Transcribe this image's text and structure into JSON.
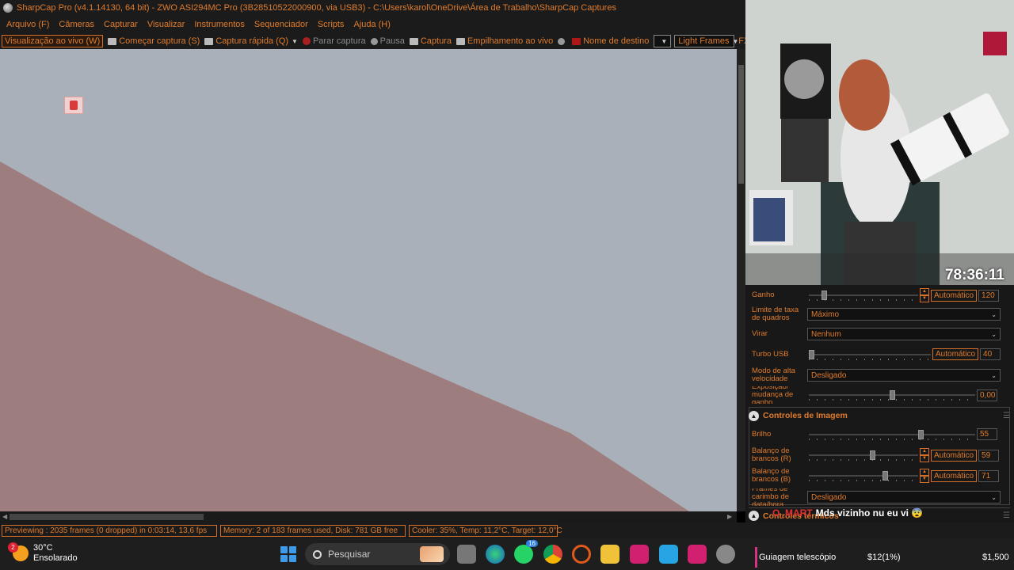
{
  "window": {
    "title": "SharpCap Pro (v4.1.14130, 64 bit) - ZWO ASI294MC Pro (3B28510522000900, via USB3) - C:\\Users\\karol\\OneDrive\\Área de Trabalho\\SharpCap Captures"
  },
  "menu": [
    "Arquivo (F)",
    "Câmeras",
    "Capturar",
    "Visualizar",
    "Instrumentos",
    "Sequenciador",
    "Scripts",
    "Ajuda (H)"
  ],
  "toolbar": {
    "live_view": "Visualização ao vivo (W)",
    "start_capture": "Começar captura (S)",
    "quick_capture": "Captura rápida (Q)",
    "stop_capture": "Parar captura",
    "pause": "Pausa",
    "snapshot": "Captura",
    "live_stack": "Empilhamento ao vivo",
    "target_name": "Nome de destino",
    "target_value": "",
    "frame_type": "Light Frames",
    "fx": "FX"
  },
  "camera_controls": {
    "gain_label": "Ganho",
    "gain_auto": "Automático",
    "gain_value": "120",
    "gain_level": 0.12,
    "frame_rate_label": "Limite de taxa de quadros",
    "frame_rate_value": "Máximo",
    "flip_label": "Virar",
    "flip_value": "Nenhum",
    "usb_label": "Turbo USB",
    "usb_auto": "Automático",
    "usb_value": "40",
    "usb_level": 0.0,
    "hs_label": "Modo de alta velocidade",
    "hs_value": "Desligado",
    "exp_label": "Exposição/ mudança de ganho",
    "exp_value": "0,00",
    "exp_level": 0.5
  },
  "image_controls": {
    "title": "Controles de Imagem",
    "brightness_label": "Brilho",
    "brightness_value": "55",
    "brightness_level": 0.68,
    "wb_r_label": "Balanço de brancos (R)",
    "wb_r_auto": "Automático",
    "wb_r_value": "59",
    "wb_r_level": 0.59,
    "wb_b_label": "Balanço de brancos (B)",
    "wb_b_auto": "Automático",
    "wb_b_value": "71",
    "wb_b_level": 0.71,
    "timestamp_label": "Frames de carimbo de data/hora",
    "timestamp_value": "Desligado"
  },
  "thermal_controls": {
    "title": "Controles térmicos"
  },
  "webcam": {
    "clock": "78:36:11"
  },
  "chat": {
    "user": "O_MART",
    "message": "Mds vizinho nu eu vi 😨"
  },
  "status": {
    "preview": "Previewing : 2035 frames (0 dropped) in 0:03:14, 13,6 fps",
    "memory": "Memory: 2 of 183 frames used, Disk: 781 GB free",
    "cooler": "Cooler: 35%, Temp: 11,2°C, Target: 12,0°C"
  },
  "taskbar": {
    "weather_temp": "30°C",
    "weather_desc": "Ensolarado",
    "weather_badge": "2",
    "search_placeholder": "Pesquisar",
    "whatsapp_badge": "16",
    "goal_label": "Guiagem telescópio",
    "goal_progress": "$12(1%)",
    "goal_target": "$1,500"
  },
  "colors": {
    "accent": "#e07c2c",
    "preview_sky": "#a9b0b9",
    "preview_wall": "#9e7d7e"
  }
}
